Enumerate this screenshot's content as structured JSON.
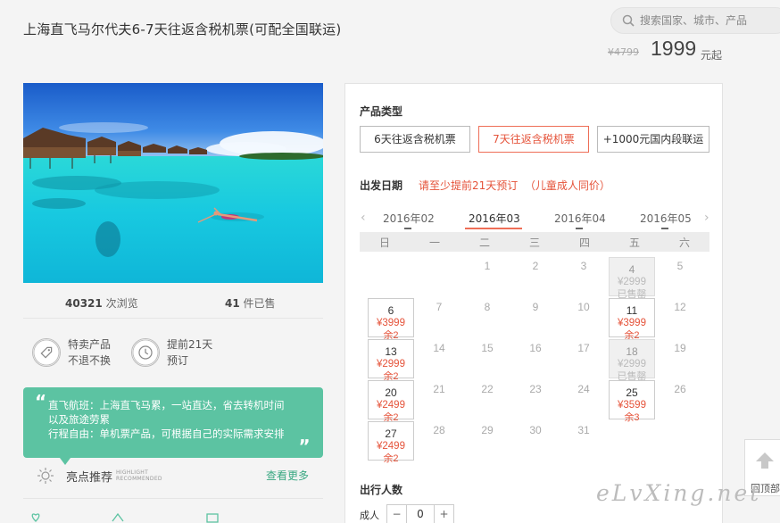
{
  "page_title": "上海直飞马尔代夫6-7天往返含税机票(可配全国联运)",
  "search": {
    "placeholder": "搜索国家、城市、产品"
  },
  "price": {
    "original": "¥4799",
    "current": "1999",
    "unit": "元起"
  },
  "stats": {
    "views_count": "40321",
    "views_label": "次浏览",
    "sold_count": "41",
    "sold_label": "件已售"
  },
  "features": [
    {
      "icon": "tag-icon",
      "line1": "特卖产品",
      "line2": "不退不换"
    },
    {
      "icon": "clock-icon",
      "line1": "提前21天",
      "line2": "预订"
    }
  ],
  "quote": {
    "line1": "直飞航班：上海直飞马累，一站直达，省去转机时间",
    "line2": "以及旅途劳累",
    "line3": "行程自由：单机票产品，可根据自己的实际需求安排"
  },
  "highlight": {
    "title": "亮点推荐",
    "sub1": "HIGHLIGHT",
    "sub2": "RECOMMENDED",
    "more": "查看更多"
  },
  "product_type": {
    "label": "产品类型",
    "options": [
      "6天往返含税机票",
      "7天往返含税机票",
      "+1000元国内段联运"
    ],
    "selected": 1
  },
  "departure": {
    "label": "出发日期",
    "note1": "请至少提前21天预订",
    "note2": "（儿童成人同价）"
  },
  "months": [
    "2016年02",
    "2016年03",
    "2016年04",
    "2016年05"
  ],
  "selected_month": "2016年03",
  "weekdays": [
    "日",
    "一",
    "二",
    "三",
    "四",
    "五",
    "六"
  ],
  "calendar": [
    {
      "day": "1",
      "col": 2,
      "row": 0
    },
    {
      "day": "2",
      "col": 3,
      "row": 0
    },
    {
      "day": "3",
      "col": 4,
      "row": 0
    },
    {
      "day": "4",
      "col": 5,
      "row": 0,
      "price": "¥2999",
      "status": "已售罄",
      "sold": true
    },
    {
      "day": "5",
      "col": 6,
      "row": 0
    },
    {
      "day": "6",
      "col": 0,
      "row": 1,
      "price": "¥3999",
      "status": "余2"
    },
    {
      "day": "7",
      "col": 1,
      "row": 1
    },
    {
      "day": "8",
      "col": 2,
      "row": 1
    },
    {
      "day": "9",
      "col": 3,
      "row": 1
    },
    {
      "day": "10",
      "col": 4,
      "row": 1
    },
    {
      "day": "11",
      "col": 5,
      "row": 1,
      "price": "¥3999",
      "status": "余2"
    },
    {
      "day": "12",
      "col": 6,
      "row": 1
    },
    {
      "day": "13",
      "col": 0,
      "row": 2,
      "price": "¥2999",
      "status": "余2"
    },
    {
      "day": "14",
      "col": 1,
      "row": 2
    },
    {
      "day": "15",
      "col": 2,
      "row": 2
    },
    {
      "day": "16",
      "col": 3,
      "row": 2
    },
    {
      "day": "17",
      "col": 4,
      "row": 2
    },
    {
      "day": "18",
      "col": 5,
      "row": 2,
      "price": "¥2999",
      "status": "已售罄",
      "sold": true
    },
    {
      "day": "19",
      "col": 6,
      "row": 2
    },
    {
      "day": "20",
      "col": 0,
      "row": 3,
      "price": "¥2499",
      "status": "余2"
    },
    {
      "day": "21",
      "col": 1,
      "row": 3
    },
    {
      "day": "22",
      "col": 2,
      "row": 3
    },
    {
      "day": "23",
      "col": 3,
      "row": 3
    },
    {
      "day": "24",
      "col": 4,
      "row": 3
    },
    {
      "day": "25",
      "col": 5,
      "row": 3,
      "price": "¥3599",
      "status": "余3"
    },
    {
      "day": "26",
      "col": 6,
      "row": 3
    },
    {
      "day": "27",
      "col": 0,
      "row": 4,
      "price": "¥2499",
      "status": "余2"
    },
    {
      "day": "28",
      "col": 1,
      "row": 4
    },
    {
      "day": "29",
      "col": 2,
      "row": 4
    },
    {
      "day": "30",
      "col": 3,
      "row": 4
    },
    {
      "day": "31",
      "col": 4,
      "row": 4
    }
  ],
  "travelers": {
    "label": "出行人数",
    "adult_label": "成人",
    "minus": "−",
    "count": "0",
    "plus": "+"
  },
  "back_to_top": "回顶部",
  "watermark": "eLvXing.net"
}
